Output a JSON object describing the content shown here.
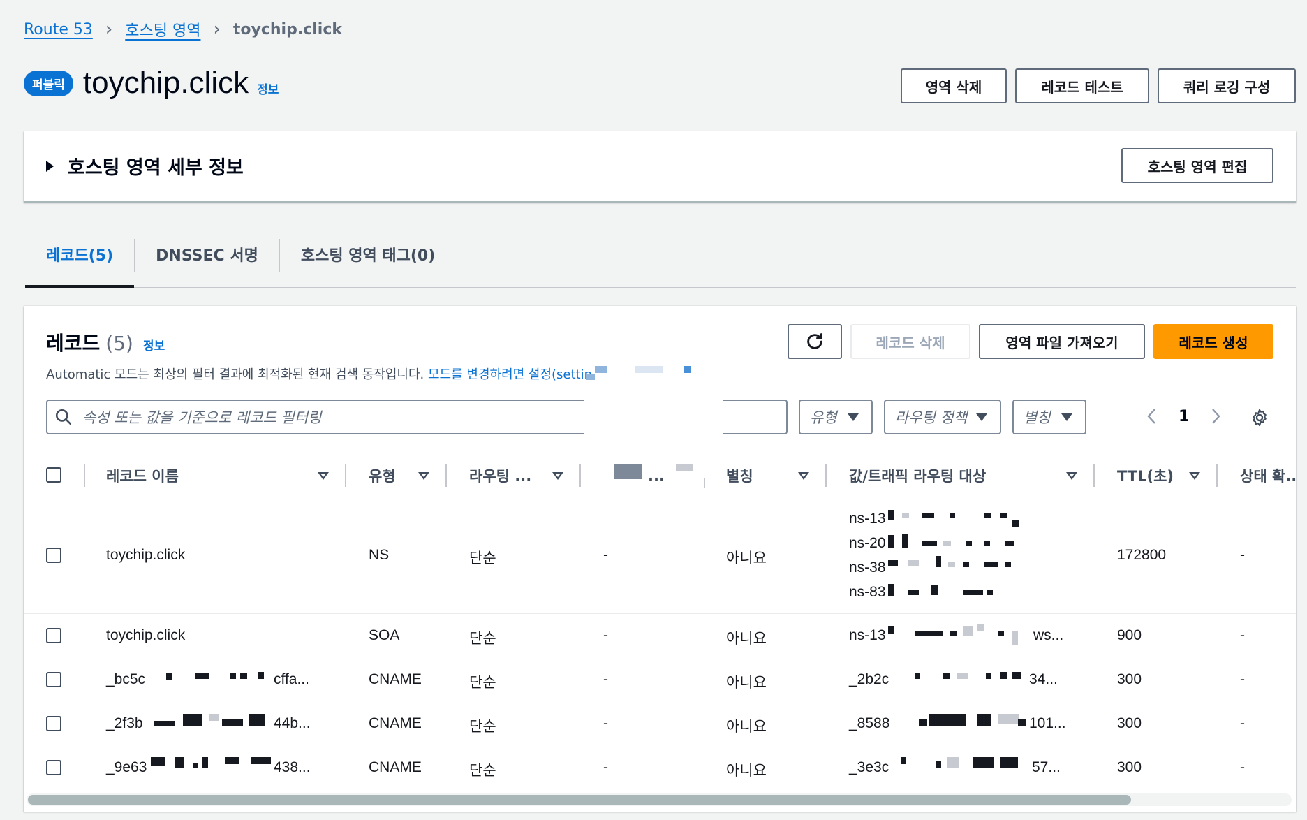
{
  "breadcrumb": {
    "root": "Route 53",
    "middle": "호스팅 영역",
    "current": "toychip.click"
  },
  "header": {
    "badge": "퍼블릭",
    "title": "toychip.click",
    "info": "정보",
    "actions": {
      "delete_zone": "영역 삭제",
      "test_record": "레코드 테스트",
      "query_logging": "쿼리 로깅 구성"
    }
  },
  "details": {
    "title": "호스팅 영역 세부 정보",
    "edit_button": "호스팅 영역 편집"
  },
  "tabs": [
    {
      "label": "레코드(5)"
    },
    {
      "label": "DNSSEC 서명"
    },
    {
      "label": "호스팅 영역 태그(0)"
    }
  ],
  "records": {
    "title": "레코드",
    "count": "(5)",
    "info": "정보",
    "description": "Automatic 모드는 최상의 필터 결과에 최적화된 현재 검색 동작입니다.",
    "description_link": "모드를 변경하려면 설정(settin",
    "buttons": {
      "delete": "레코드 삭제",
      "import": "영역 파일 가져오기",
      "create": "레코드 생성"
    },
    "search_placeholder": "속성 또는 값을 기준으로 레코드 필터링",
    "filters": {
      "type": "유형",
      "routing": "라우팅 정책",
      "alias": "별칭"
    },
    "page": "1",
    "columns": {
      "name": "레코드 이름",
      "type": "유형",
      "routing": "라우팅 ...",
      "differentiator": "...",
      "alias": "별칭",
      "value": "값/트래픽 라우팅 대상",
      "ttl": "TTL(초)",
      "health": "상태 확.."
    },
    "rows": [
      {
        "name": "toychip.click",
        "type": "NS",
        "routing": "단순",
        "diff": "-",
        "alias": "아니요",
        "values": [
          "ns-13",
          "ns-20",
          "ns-38",
          "ns-83"
        ],
        "ttl": "172800",
        "health": "-"
      },
      {
        "name": "toychip.click",
        "type": "SOA",
        "routing": "단순",
        "diff": "-",
        "alias": "아니요",
        "values": [
          "ns-13"
        ],
        "value_tail": "ws...",
        "ttl": "900",
        "health": "-"
      },
      {
        "name": "_bc5c",
        "name_tail": "cffa...",
        "type": "CNAME",
        "routing": "단순",
        "diff": "-",
        "alias": "아니요",
        "values": [
          "_2b2c"
        ],
        "value_tail": "34...",
        "ttl": "300",
        "health": "-"
      },
      {
        "name": "_2f3b",
        "name_tail": "44b...",
        "type": "CNAME",
        "routing": "단순",
        "diff": "-",
        "alias": "아니요",
        "values": [
          "_8588"
        ],
        "value_tail": "101...",
        "ttl": "300",
        "health": "-"
      },
      {
        "name": "_9e63",
        "name_tail": "438...",
        "type": "CNAME",
        "routing": "단순",
        "diff": "-",
        "alias": "아니요",
        "values": [
          "_3e3c"
        ],
        "value_tail": "57...",
        "ttl": "300",
        "health": "-"
      }
    ]
  }
}
